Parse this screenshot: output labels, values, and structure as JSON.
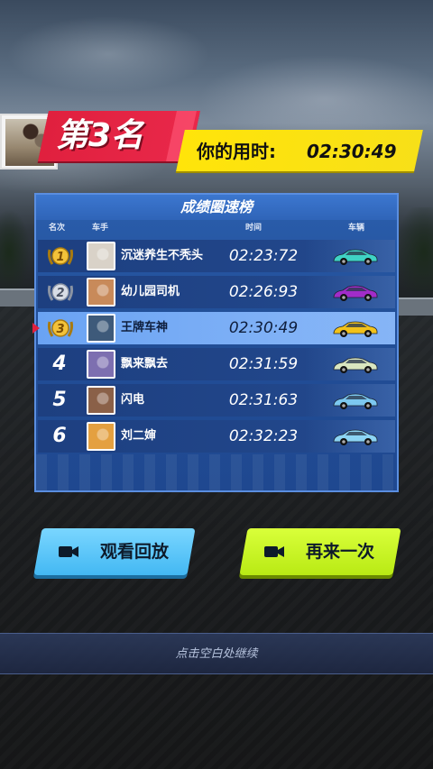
{
  "header": {
    "rank_label": "第3名",
    "time_label": "你的用时:",
    "time_value": "02:30:49"
  },
  "leaderboard": {
    "title": "成绩圈速榜",
    "columns": {
      "rank": "名次",
      "driver": "车手",
      "time": "时间",
      "vehicle": "车辆"
    },
    "rows": [
      {
        "rank": "1",
        "name": "沉迷养生不秃头",
        "time": "02:23:72",
        "medal": "gold",
        "car_color": "#3fd2c4",
        "avatar_color": "#d9d2c8",
        "highlight": false
      },
      {
        "rank": "2",
        "name": "幼儿园司机",
        "time": "02:26:93",
        "medal": "silver",
        "car_color": "#a12cc9",
        "avatar_color": "#c88a5a",
        "highlight": false
      },
      {
        "rank": "3",
        "name": "王牌车神",
        "time": "02:30:49",
        "medal": "bronze",
        "car_color": "#f2c21a",
        "avatar_color": "#3e5a7a",
        "highlight": true
      },
      {
        "rank": "4",
        "name": "飘来飘去",
        "time": "02:31:59",
        "medal": "none",
        "car_color": "#d9e6c0",
        "avatar_color": "#7d6fb0",
        "highlight": false
      },
      {
        "rank": "5",
        "name": "闪电",
        "time": "02:31:63",
        "medal": "none",
        "car_color": "#7cc8f0",
        "avatar_color": "#8a6048",
        "highlight": false
      },
      {
        "rank": "6",
        "name": "刘二婶",
        "time": "02:32:23",
        "medal": "none",
        "car_color": "#8cd4f4",
        "avatar_color": "#e4a040",
        "highlight": false
      }
    ]
  },
  "buttons": {
    "replay": "观看回放",
    "retry": "再来一次"
  },
  "continue_text": "点击空白处继续",
  "icons": {
    "replay_icon": "video-camera-icon",
    "retry_icon": "video-camera-icon"
  }
}
